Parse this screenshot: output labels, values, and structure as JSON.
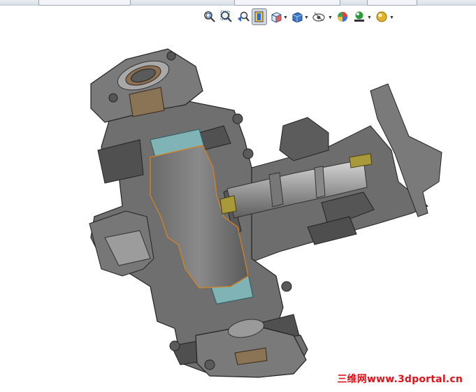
{
  "toolbar": {
    "items": [
      {
        "icon": "zoom-to-fit-icon"
      },
      {
        "icon": "zoom-to-area-icon"
      },
      {
        "icon": "previous-view-icon"
      },
      {
        "icon": "section-view-icon",
        "active": true
      },
      {
        "icon": "view-orientation-icon",
        "dropdown": true
      },
      {
        "icon": "display-style-icon",
        "dropdown": true
      },
      {
        "icon": "hide-show-items-icon",
        "dropdown": true
      },
      {
        "icon": "edit-appearance-icon"
      },
      {
        "icon": "apply-scene-icon",
        "dropdown": true
      },
      {
        "icon": "view-settings-icon",
        "dropdown": true
      }
    ]
  },
  "viewport": {
    "model": "valve-assembly-section",
    "colors": {
      "body": "#6d6d6d",
      "body_dark": "#4b4b4b",
      "body_light": "#8a8a8a",
      "seal": "#7fb3b6",
      "plug_outline": "#d7821f",
      "stem_light": "#c9c9c9",
      "brass": "#8b7355"
    }
  },
  "watermark": {
    "text": "三维网www.3dportal.cn",
    "color": "#e0121a"
  }
}
